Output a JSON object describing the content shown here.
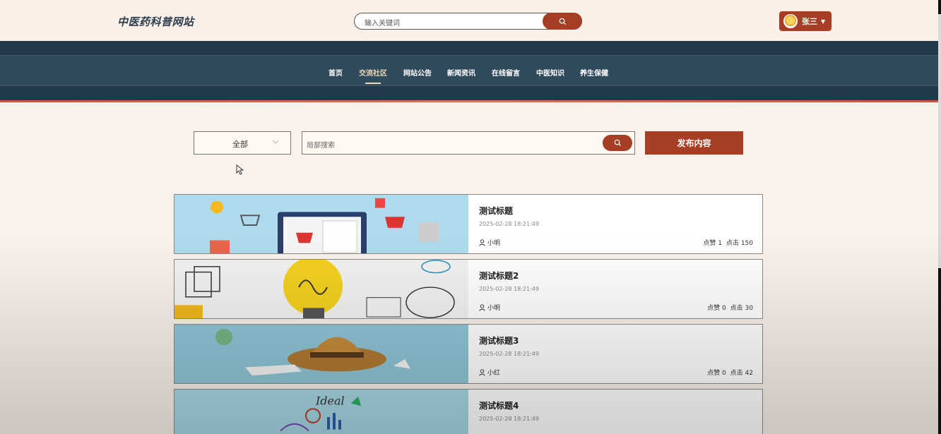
{
  "header": {
    "brand": "中医药科普网站",
    "search_placeholder": "输入关键词",
    "user_name": "张三"
  },
  "nav": {
    "items": [
      {
        "label": "首页",
        "active": false
      },
      {
        "label": "交流社区",
        "active": true
      },
      {
        "label": "网站公告",
        "active": false
      },
      {
        "label": "新闻资讯",
        "active": false
      },
      {
        "label": "在线留言",
        "active": false
      },
      {
        "label": "中医知识",
        "active": false
      },
      {
        "label": "养生保健",
        "active": false
      }
    ]
  },
  "filter": {
    "category": "全部",
    "search_placeholder": "局部搜索",
    "publish_label": "发布内容"
  },
  "posts": [
    {
      "title": "测试标题",
      "time": "2025-02-28 18:21:49",
      "author": "小明",
      "likes_label": "点赞 1",
      "clicks_label": "点击 150"
    },
    {
      "title": "测试标题2",
      "time": "2025-02-28 18:21:49",
      "author": "小明",
      "likes_label": "点赞 0",
      "clicks_label": "点击 30"
    },
    {
      "title": "测试标题3",
      "time": "2025-02-28 18:21:49",
      "author": "小红",
      "likes_label": "点赞 0",
      "clicks_label": "点击 42"
    },
    {
      "title": "测试标题4",
      "time": "2025-02-28 18:21:49",
      "author": "",
      "likes_label": "",
      "clicks_label": ""
    }
  ],
  "colors": {
    "accent": "#a53e24",
    "nav_bg": "#2f4a5b",
    "page_bg": "#f9f1ea"
  }
}
